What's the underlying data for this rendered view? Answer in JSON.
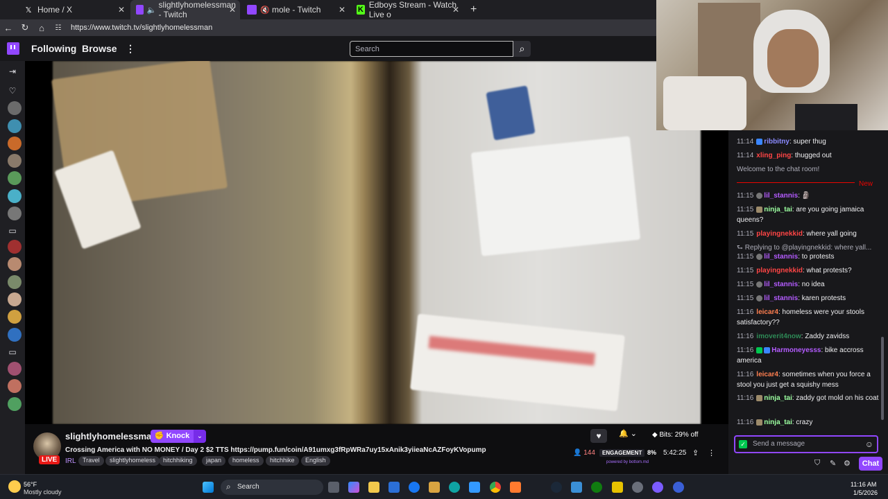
{
  "browser": {
    "tabs": [
      {
        "label": "Home / X",
        "icon": "x-logo-icon"
      },
      {
        "label": "slightlyhomelessman - Twitch",
        "icon": "twitch-icon"
      },
      {
        "label": "mole - Twitch",
        "icon": "twitch-icon"
      },
      {
        "label": "Edboys Stream - Watch Live o",
        "icon": "kick-icon"
      }
    ],
    "new_tab": "+",
    "url": "https://www.twitch.tv/slightlyhomelessman"
  },
  "topnav": {
    "following": "Following",
    "browse": "Browse",
    "more": "⋮",
    "search_placeholder": "Search"
  },
  "stream": {
    "channel": "slightlyhomelessman",
    "live": "LIVE",
    "knock": "Knock",
    "title": "Crossing America with NO MONEY / Day 2 $2 TTS https://pump.fun/coin/A91umxg3fRpWRa7uy15xAnik3yiieaNcAZFoyKVopump",
    "category": "IRL",
    "tags": [
      "Travel",
      "slightlyhomeless",
      "hitchhiking",
      "japan",
      "homeless",
      "hitchhike",
      "English"
    ],
    "bits": "Bits: 29% off",
    "viewers": "144",
    "engagement": "ENGAGEMENT",
    "engagement_pct": "8%",
    "uptime": "5:42:25",
    "powered": "powered by",
    "powered_brand": "bottom.md"
  },
  "chat": {
    "messages": [
      {
        "time": "11:14",
        "user": "ribbitny",
        "text": ": super thug",
        "color": "#8a8aff"
      },
      {
        "time": "11:14",
        "user": "xling_ping",
        "text": ": thugged out",
        "color": "#ff4545"
      },
      {
        "time": "",
        "user": "",
        "text": "Welcome to the chat room!",
        "color": "#adadb8"
      },
      {
        "time": "11:15",
        "user": "lil_stannis",
        "text": ": 🗿",
        "color": "#b45cff"
      },
      {
        "time": "11:15",
        "user": "ninja_tai",
        "text": ": are you going jamaica queens?",
        "color": "#9cffa0"
      },
      {
        "time": "11:15",
        "user": "playingnekkid",
        "text": ": where yall going",
        "color": "#ff4545"
      },
      {
        "time": "",
        "user": "",
        "text": "Replying to @playingnekkid: where yall...",
        "color": "#adadb8"
      },
      {
        "time": "11:15",
        "user": "lil_stannis",
        "text": ": to protests",
        "color": "#b45cff"
      },
      {
        "time": "11:15",
        "user": "playingnekkid",
        "text": ": what protests?",
        "color": "#ff4545"
      },
      {
        "time": "11:15",
        "user": "lil_stannis",
        "text": ": no idea",
        "color": "#b45cff"
      },
      {
        "time": "11:15",
        "user": "lil_stannis",
        "text": ": karen protests",
        "color": "#b45cff"
      },
      {
        "time": "11:16",
        "user": "leicar4",
        "text": ": homeless were your stools satisfactory??",
        "color": "#ff7f50"
      },
      {
        "time": "11:16",
        "user": "imoverit4now",
        "text": ": Zaddy zavidss",
        "color": "#2e8b57"
      },
      {
        "time": "11:16",
        "user": "Harmoneyesss",
        "text": ": bike accross america",
        "color": "#b45cff"
      },
      {
        "time": "11:16",
        "user": "leicar4",
        "text": ": sometimes when you force a stool you just get a squishy mess",
        "color": "#ff7f50"
      },
      {
        "time": "11:16",
        "user": "ninja_tai",
        "text": ": zaddy got mold on his coat",
        "color": "#9cffa0"
      },
      {
        "time": "11:16",
        "user": "ninja_tai",
        "text": ": crazy",
        "color": "#9cffa0"
      }
    ],
    "new_label": "New",
    "input_placeholder": "Send a message",
    "chat_button": "Chat"
  },
  "taskbar": {
    "weather_temp": "56°F",
    "weather_desc": "Mostly cloudy",
    "search": "Search",
    "time": "11:16 AM",
    "date": "1/5/2026"
  },
  "colors": {
    "twitch_purple": "#9147ff",
    "live_red": "#e91916",
    "new_red": "#eb0400"
  }
}
